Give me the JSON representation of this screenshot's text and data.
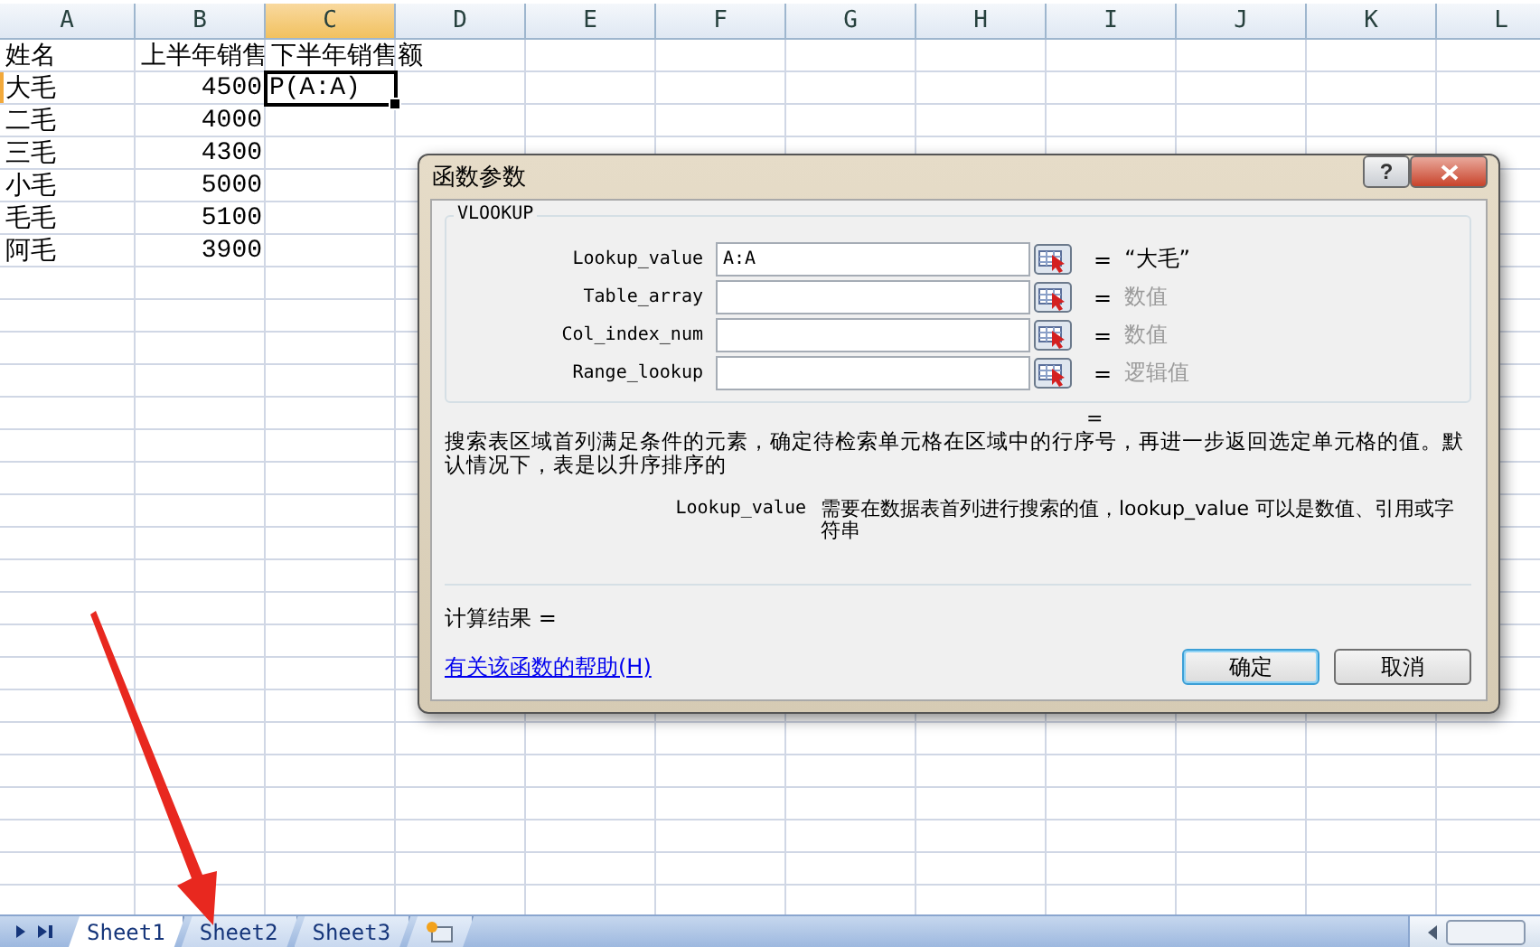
{
  "columns": [
    {
      "label": "A",
      "selected": false
    },
    {
      "label": "B",
      "selected": false
    },
    {
      "label": "C",
      "selected": true
    },
    {
      "label": "D",
      "selected": false
    },
    {
      "label": "E",
      "selected": false
    },
    {
      "label": "F",
      "selected": false
    },
    {
      "label": "G",
      "selected": false
    },
    {
      "label": "H",
      "selected": false
    },
    {
      "label": "I",
      "selected": false
    },
    {
      "label": "J",
      "selected": false
    },
    {
      "label": "K",
      "selected": false
    },
    {
      "label": "L",
      "selected": false
    }
  ],
  "rows": [
    {
      "selected": false,
      "cells": [
        {
          "text": "姓名",
          "kind": "text"
        },
        {
          "text": "上半年销售",
          "kind": "text"
        },
        {
          "text": "下半年销售额",
          "kind": "text"
        }
      ]
    },
    {
      "selected": true,
      "cells": [
        {
          "text": "大毛",
          "kind": "text"
        },
        {
          "text": "4500",
          "kind": "number"
        },
        {
          "text": "P(A:A)",
          "kind": "text",
          "active": true
        }
      ]
    },
    {
      "selected": false,
      "cells": [
        {
          "text": "二毛",
          "kind": "text"
        },
        {
          "text": "4000",
          "kind": "number"
        }
      ]
    },
    {
      "selected": false,
      "cells": [
        {
          "text": "三毛",
          "kind": "text"
        },
        {
          "text": "4300",
          "kind": "number"
        }
      ]
    },
    {
      "selected": false,
      "cells": [
        {
          "text": "小毛",
          "kind": "text"
        },
        {
          "text": "5000",
          "kind": "number"
        }
      ]
    },
    {
      "selected": false,
      "cells": [
        {
          "text": "毛毛",
          "kind": "text"
        },
        {
          "text": "5100",
          "kind": "number"
        }
      ]
    },
    {
      "selected": false,
      "cells": [
        {
          "text": "阿毛",
          "kind": "text"
        },
        {
          "text": "3900",
          "kind": "number"
        }
      ]
    }
  ],
  "dialog": {
    "title": "函数参数",
    "help_button": "?",
    "function_name": "VLOOKUP",
    "arguments": [
      {
        "label": "Lookup_value",
        "value": "A:A",
        "equals": "=",
        "result": "“大毛”",
        "result_is_hint": false
      },
      {
        "label": "Table_array",
        "equals": "=",
        "result": "数值",
        "result_is_hint": true
      },
      {
        "label": "Col_index_num",
        "equals": "=",
        "result": "数值",
        "result_is_hint": true
      },
      {
        "label": "Range_lookup",
        "equals": "=",
        "result": "逻辑值",
        "result_is_hint": true
      }
    ],
    "formula_result": "=",
    "description": "搜索表区域首列满足条件的元素，确定待检索单元格在区域中的行序号，再进一步返回选定单元格的值。默认情况下，表是以升序排序的",
    "param_name": "Lookup_value",
    "param_description": "需要在数据表首列进行搜索的值，lookup_value 可以是数值、引用或字符串",
    "result_label": "计算结果 =",
    "help_link": "有关该函数的帮助(H)",
    "buttons": [
      {
        "label": "确定",
        "default": true
      },
      {
        "label": "取消",
        "default": false
      }
    ]
  },
  "sheet_tabs": [
    {
      "label": "Sheet1",
      "selected": true
    },
    {
      "label": "Sheet2",
      "selected": false
    },
    {
      "label": "Sheet3",
      "selected": false
    }
  ]
}
